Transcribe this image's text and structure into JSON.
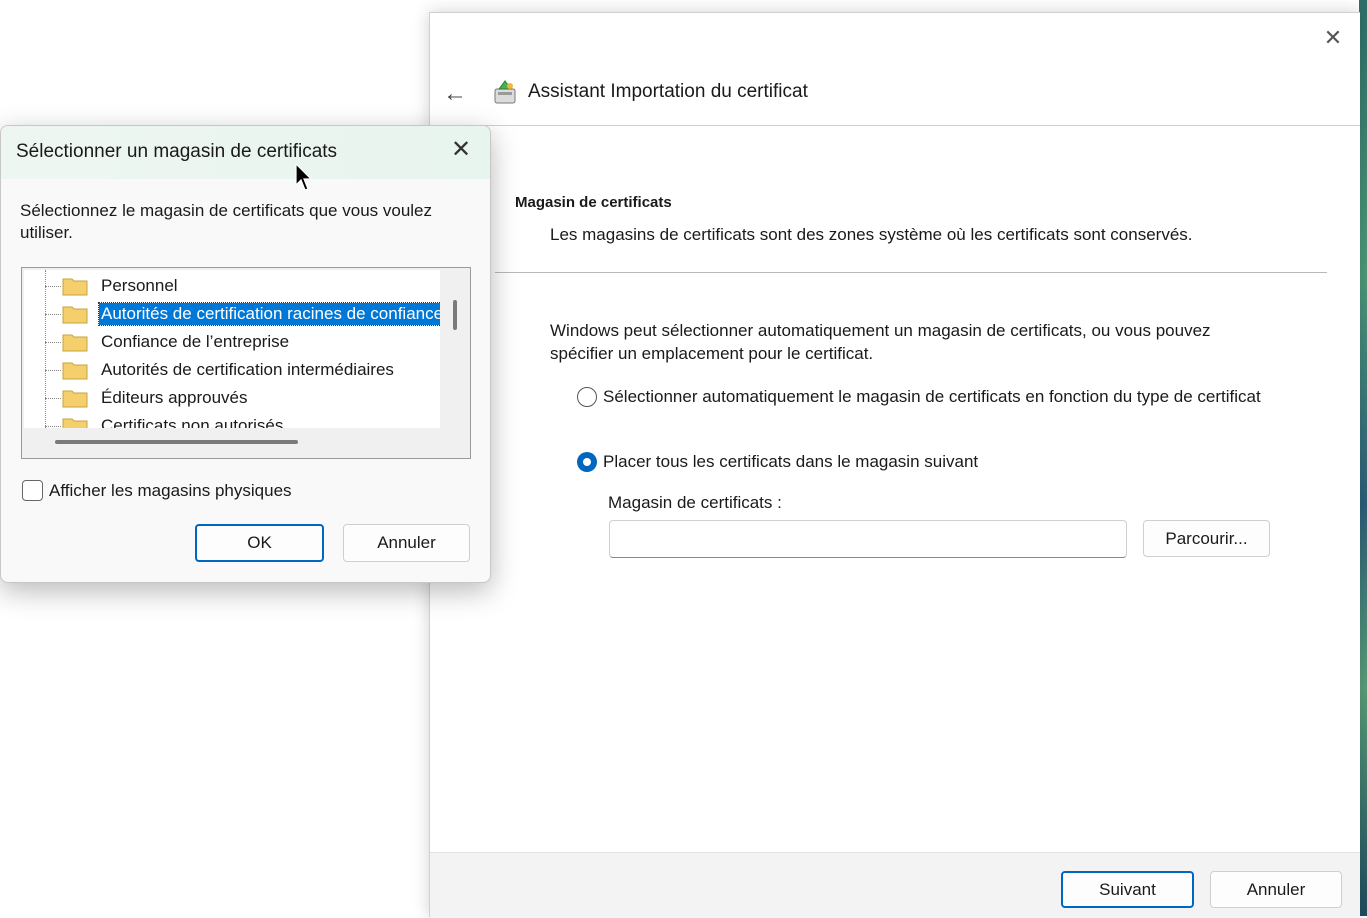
{
  "wizard": {
    "title": "Assistant Importation du certificat",
    "section_title": "Magasin de certificats",
    "section_desc": "Les magasins de certificats sont des zones système où les certificats sont conservés.",
    "intro": "Windows peut sélectionner automatiquement un magasin de certificats, ou vous pouvez spécifier un emplacement pour le certificat.",
    "options": [
      {
        "label": "Sélectionner automatiquement le magasin de certificats en fonction du type de certificat",
        "checked": false
      },
      {
        "label": "Placer tous les certificats dans le magasin suivant",
        "checked": true
      }
    ],
    "store_label": "Magasin de certificats :",
    "store_value": "",
    "browse_label": "Parcourir...",
    "next_label": "Suivant",
    "cancel_label": "Annuler",
    "icons": {
      "back": "back-arrow-icon",
      "close": "close-icon",
      "wizard": "certificate-wizard-icon"
    }
  },
  "dialog": {
    "title": "Sélectionner un magasin de certificats",
    "prompt": "Sélectionnez le magasin de certificats que vous voulez utiliser.",
    "stores": [
      {
        "label": "Personnel",
        "selected": false
      },
      {
        "label": "Autorités de certification racines de confiance",
        "selected": true
      },
      {
        "label": "Confiance de l’entreprise",
        "selected": false
      },
      {
        "label": "Autorités de certification intermédiaires",
        "selected": false
      },
      {
        "label": "Éditeurs approuvés",
        "selected": false
      },
      {
        "label": "Certificats non autorisés",
        "selected": false
      }
    ],
    "show_physical_label": "Afficher les magasins physiques",
    "show_physical_checked": false,
    "ok_label": "OK",
    "cancel_label": "Annuler"
  },
  "colors": {
    "accent": "#0067c0",
    "selection": "#0078d7",
    "folder": "#f4cf6b"
  }
}
